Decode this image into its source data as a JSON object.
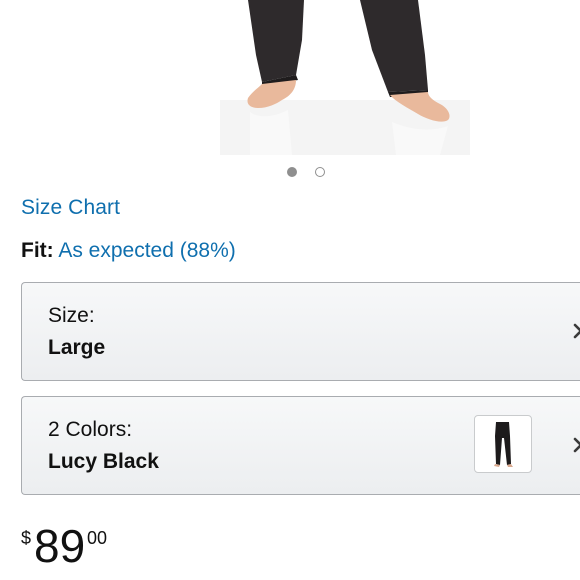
{
  "carousel": {
    "image_alt": "model wearing black pants, barefoot",
    "dot_count": 2,
    "active_index": 0
  },
  "size_chart": {
    "label": "Size Chart"
  },
  "fit": {
    "label": "Fit:",
    "value": "As expected (88%)"
  },
  "size_selector": {
    "label": "Size:",
    "value": "Large",
    "icon": "chevron-right-icon"
  },
  "color_selector": {
    "label": "2 Colors:",
    "value": "Lucy Black",
    "swatch": "black-pants-thumbnail",
    "icon": "chevron-right-icon"
  },
  "price": {
    "currency": "$",
    "whole": "89",
    "fraction": "00"
  },
  "colors": {
    "link": "#0f6fae",
    "text": "#111111",
    "border": "#a9acb0"
  }
}
